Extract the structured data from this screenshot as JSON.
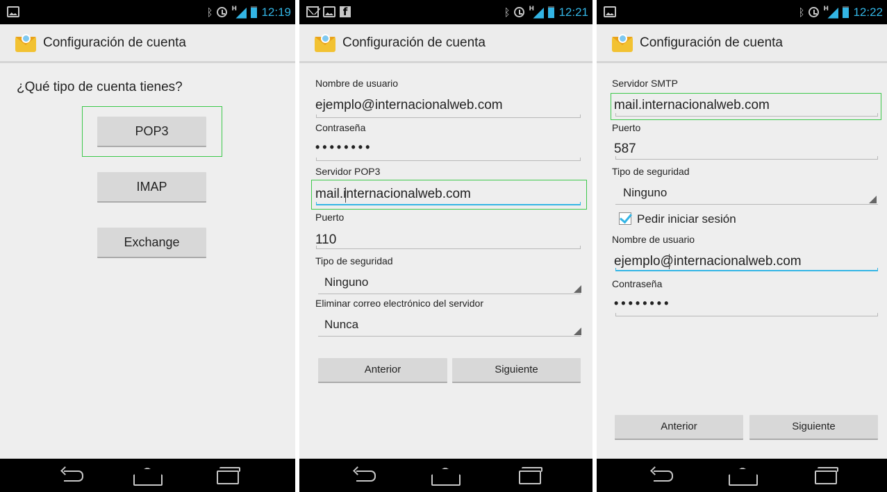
{
  "app_title": "Configuración de cuenta",
  "screens": [
    {
      "time": "12:19",
      "question": "¿Qué tipo de cuenta tienes?",
      "options": [
        "POP3",
        "IMAP",
        "Exchange"
      ]
    },
    {
      "time": "12:21",
      "fields": {
        "username_label": "Nombre de usuario",
        "username_value": "ejemplo@internacionalweb.com",
        "password_label": "Contraseña",
        "password_value": "••••••••",
        "server_label": "Servidor POP3",
        "server_value_a": "mail",
        "server_value_b": ".internacionalweb.com",
        "port_label": "Puerto",
        "port_value": "110",
        "security_label": "Tipo de seguridad",
        "security_value": "Ninguno",
        "delete_label": "Eliminar correo electrónico del servidor",
        "delete_value": "Nunca"
      },
      "buttons": {
        "previous": "Anterior",
        "next": "Siguiente"
      }
    },
    {
      "time": "12:22",
      "fields": {
        "smtp_label": "Servidor SMTP",
        "smtp_value": "mail.internacionalweb.com",
        "port_label": "Puerto",
        "port_value": "587",
        "security_label": "Tipo de seguridad",
        "security_value": "Ninguno",
        "require_login_label": "Pedir iniciar sesión",
        "username_label": "Nombre de usuario",
        "username_value_a": "ejemplo",
        "username_value_b": "@internacionalweb.com",
        "password_label": "Contraseña",
        "password_value": "••••••••"
      },
      "buttons": {
        "previous": "Anterior",
        "next": "Siguiente"
      }
    }
  ],
  "status_icons": [
    "picture-icon",
    "mail-icon",
    "facebook-icon",
    "bluetooth-icon",
    "alarm-icon",
    "signal-icon",
    "battery-icon"
  ],
  "nav_icons": [
    "back-icon",
    "home-icon",
    "recent-apps-icon"
  ],
  "colors": {
    "accent": "#33b5e5",
    "highlight": "#3cc84a",
    "background": "#eeeeee",
    "button": "#d8d8d8"
  }
}
